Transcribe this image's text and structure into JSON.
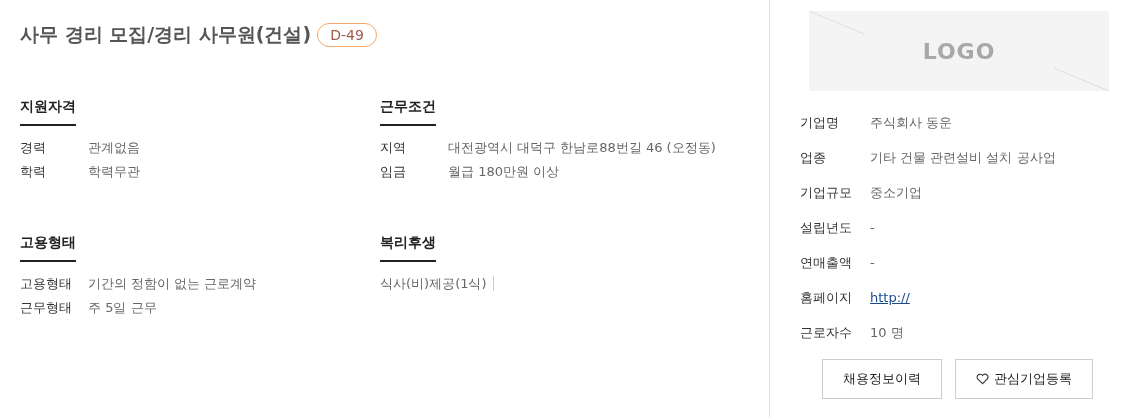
{
  "title": "사무 경리 모집/경리 사무원(건설)",
  "badge": "D-49",
  "sections": [
    {
      "heading": "지원자격",
      "kind": "pairs",
      "rows": [
        {
          "label": "경력",
          "value": "관계없음"
        },
        {
          "label": "학력",
          "value": "학력무관"
        }
      ]
    },
    {
      "heading": "근무조건",
      "kind": "pairs",
      "rows": [
        {
          "label": "지역",
          "value": "대전광역시 대덕구 한남로88번길 46 (오정동)"
        },
        {
          "label": "임금",
          "value": "월급 180만원 이상"
        }
      ]
    },
    {
      "heading": "고용형태",
      "kind": "pairs",
      "rows": [
        {
          "label": "고용형태",
          "value": "기간의 정함이 없는 근로계약"
        },
        {
          "label": "근무형태",
          "value": "주 5일 근무"
        }
      ]
    },
    {
      "heading": "복리후생",
      "kind": "tags",
      "items": [
        "식사(비)제공(1식)"
      ]
    }
  ],
  "company": {
    "logo": "LOGO",
    "rows": [
      {
        "label": "기업명",
        "value": "주식회사 동운",
        "kind": "text"
      },
      {
        "label": "업종",
        "value": "기타 건물 관련설비 설치 공사업",
        "kind": "text"
      },
      {
        "label": "기업규모",
        "value": "중소기업",
        "kind": "text"
      },
      {
        "label": "설립년도",
        "value": "-",
        "kind": "text"
      },
      {
        "label": "연매출액",
        "value": "-",
        "kind": "text"
      },
      {
        "label": "홈페이지",
        "value": "http://",
        "kind": "link"
      },
      {
        "label": "근로자수",
        "value": "10 명",
        "kind": "text"
      }
    ],
    "buttons": [
      {
        "label": "채용정보이력",
        "kind": "history"
      },
      {
        "label": "관심기업등록",
        "kind": "favorite"
      }
    ]
  }
}
